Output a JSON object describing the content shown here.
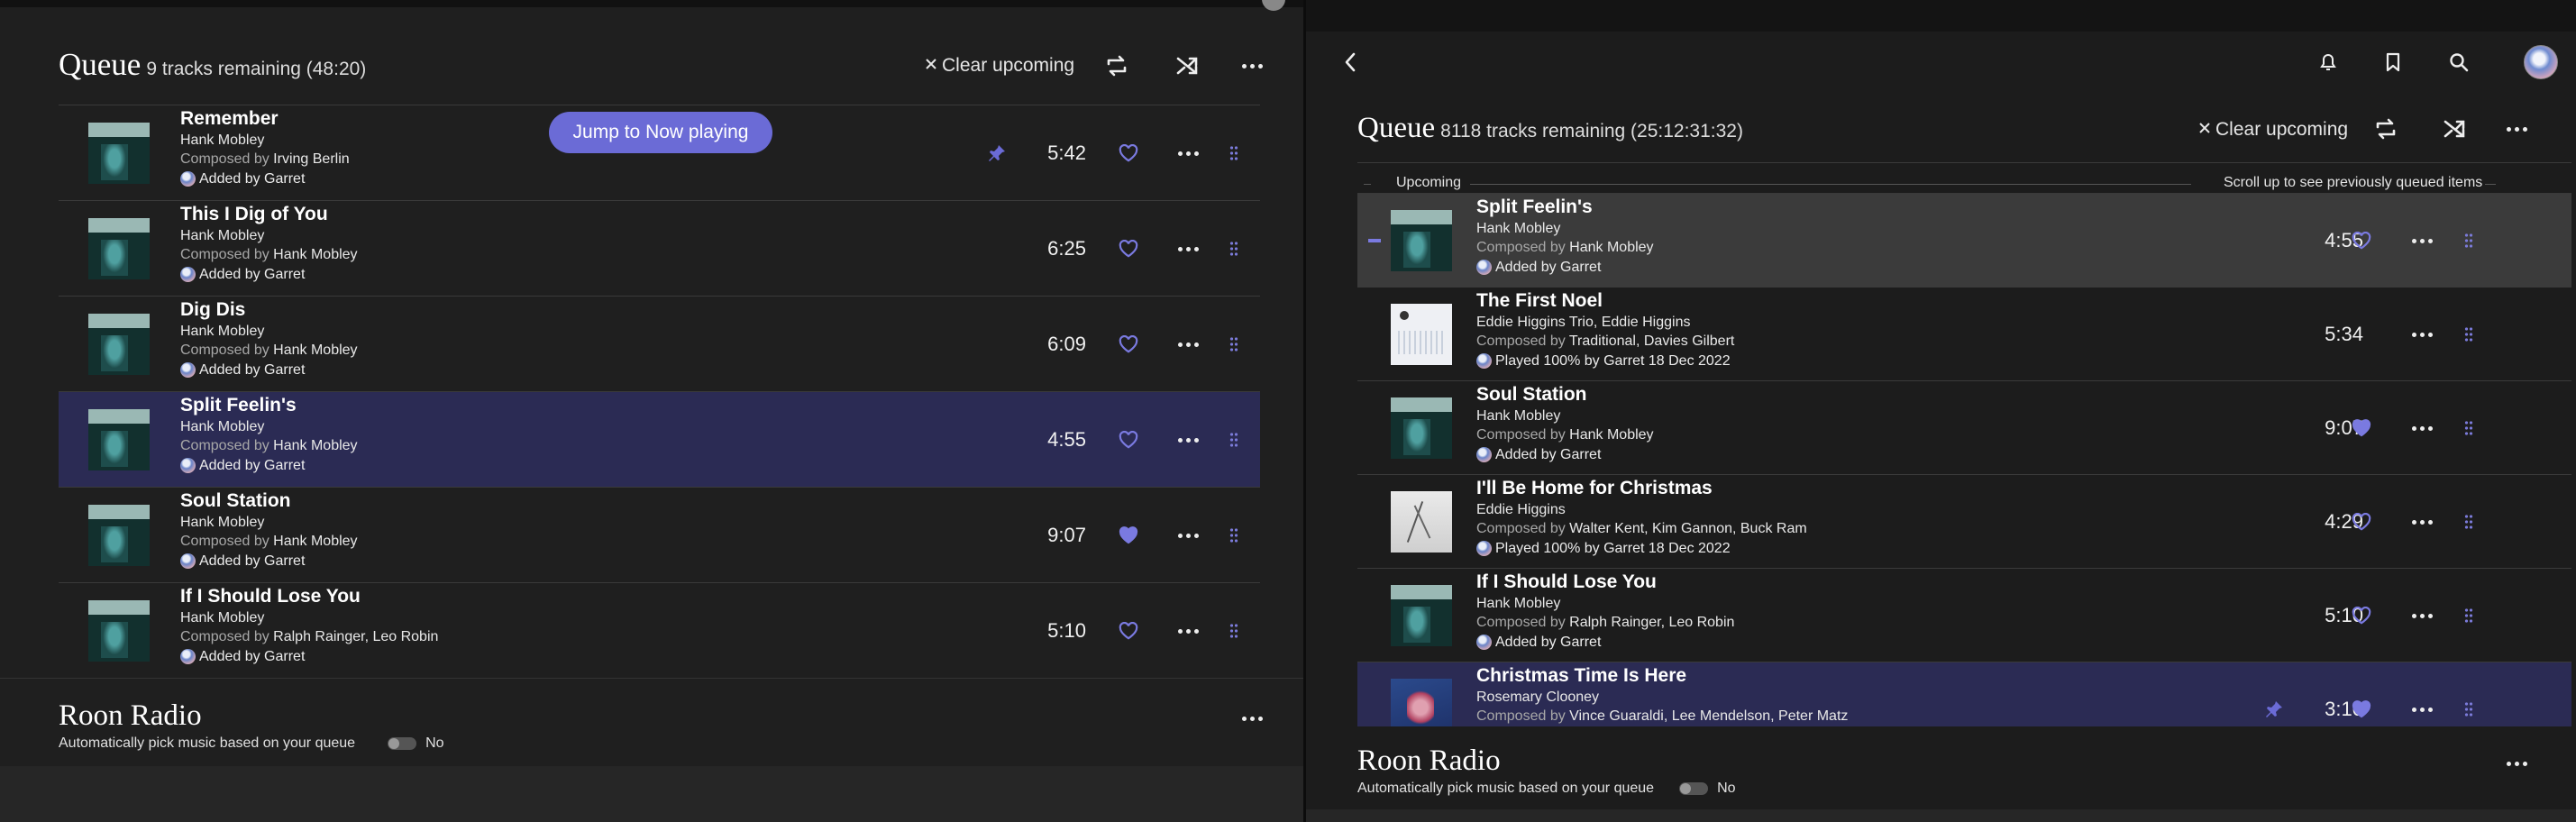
{
  "colors": {
    "accent": "#6b6bd6",
    "selected_row": "#2b2b54",
    "playing_row": "#3b3b3b"
  },
  "left": {
    "queue_title": "Queue",
    "queue_count": "9 tracks remaining (48:20)",
    "clear_label": "Clear upcoming",
    "jump_label": "Jump to Now playing",
    "rows": [
      {
        "title": "Remember",
        "artist": "Hank Mobley",
        "composed_prefix": "Composed by",
        "composers": "Irving Berlin",
        "added": "Added by Garret",
        "duration": "5:42",
        "liked": false,
        "pinned": true,
        "art": "mobley"
      },
      {
        "title": "This I Dig of You",
        "artist": "Hank Mobley",
        "composed_prefix": "Composed by",
        "composers": "Hank Mobley",
        "added": "Added by Garret",
        "duration": "6:25",
        "liked": false,
        "pinned": false,
        "art": "mobley"
      },
      {
        "title": "Dig Dis",
        "artist": "Hank Mobley",
        "composed_prefix": "Composed by",
        "composers": "Hank Mobley",
        "added": "Added by Garret",
        "duration": "6:09",
        "liked": false,
        "pinned": false,
        "art": "mobley"
      },
      {
        "title": "Split Feelin's",
        "artist": "Hank Mobley",
        "composed_prefix": "Composed by",
        "composers": "Hank Mobley",
        "added": "Added by Garret",
        "duration": "4:55",
        "liked": false,
        "pinned": false,
        "art": "mobley",
        "selected": true
      },
      {
        "title": "Soul Station",
        "artist": "Hank Mobley",
        "composed_prefix": "Composed by",
        "composers": "Hank Mobley",
        "added": "Added by Garret",
        "duration": "9:07",
        "liked": true,
        "pinned": false,
        "art": "mobley"
      },
      {
        "title": "If I Should Lose You",
        "artist": "Hank Mobley",
        "composed_prefix": "Composed by",
        "composers": "Ralph Rainger, Leo Robin",
        "added": "Added by Garret",
        "duration": "5:10",
        "liked": false,
        "pinned": false,
        "art": "mobley"
      }
    ],
    "radio_title": "Roon Radio",
    "radio_sub": "Automatically pick music based on your queue",
    "radio_toggle": "No"
  },
  "right": {
    "queue_title": "Queue",
    "queue_count": "8118 tracks remaining (25:12:31:32)",
    "clear_label": "Clear upcoming",
    "upcoming_label": "Upcoming",
    "scroll_hint": "Scroll up to see previously queued items",
    "rows": [
      {
        "title": "Split Feelin's",
        "artist": "Hank Mobley",
        "composed_prefix": "Composed by",
        "composers": "Hank Mobley",
        "added": "Added by Garret",
        "duration": "4:55",
        "liked": false,
        "pinned": false,
        "art": "mobley",
        "playing": true
      },
      {
        "title": "The First Noel",
        "artist": "Eddie Higgins Trio, Eddie Higgins",
        "composed_prefix": "Composed by",
        "composers": "Traditional, Davies Gilbert",
        "added": "Played 100% by Garret 18 Dec 2022",
        "duration": "5:34",
        "liked": null,
        "pinned": false,
        "art": "noel"
      },
      {
        "title": "Soul Station",
        "artist": "Hank Mobley",
        "composed_prefix": "Composed by",
        "composers": "Hank Mobley",
        "added": "Added by Garret",
        "duration": "9:07",
        "liked": true,
        "pinned": false,
        "art": "mobley"
      },
      {
        "title": "I'll Be Home for Christmas",
        "artist": "Eddie Higgins",
        "composed_prefix": "Composed by",
        "composers": "Walter Kent, Kim Gannon, Buck Ram",
        "added": "Played 100% by Garret 18 Dec 2022",
        "duration": "4:29",
        "liked": false,
        "pinned": false,
        "art": "winter"
      },
      {
        "title": "If I Should Lose You",
        "artist": "Hank Mobley",
        "composed_prefix": "Composed by",
        "composers": "Ralph Rainger, Leo Robin",
        "added": "Added by Garret",
        "duration": "5:10",
        "liked": false,
        "pinned": false,
        "art": "mobley"
      },
      {
        "title": "Christmas Time Is Here",
        "artist": "Rosemary Clooney",
        "composed_prefix": "Composed by",
        "composers": "Vince Guaraldi, Lee Mendelson, Peter Matz",
        "added": "",
        "duration": "3:10",
        "liked": true,
        "pinned": true,
        "art": "clooney",
        "selected": true
      }
    ],
    "radio_title": "Roon Radio",
    "radio_sub": "Automatically pick music based on your queue",
    "radio_toggle": "No"
  }
}
